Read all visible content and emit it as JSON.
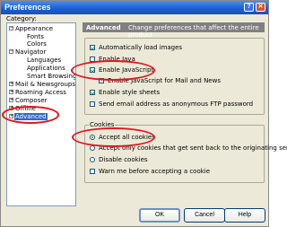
{
  "window": {
    "title": "Preferences",
    "help_glyph": "?",
    "close_glyph": "✕",
    "icons": [
      "help-icon",
      "close-icon"
    ]
  },
  "sidebar": {
    "label": "Category:",
    "items": [
      {
        "label": "Appearance",
        "toggle": "−"
      },
      {
        "label": "Fonts"
      },
      {
        "label": "Colors"
      },
      {
        "label": "Navigator",
        "toggle": "−"
      },
      {
        "label": "Languages"
      },
      {
        "label": "Applications"
      },
      {
        "label": "Smart Browsing"
      },
      {
        "label": "Mail & Newsgroups",
        "toggle": "+"
      },
      {
        "label": "Roaming Access",
        "toggle": "+"
      },
      {
        "label": "Composer",
        "toggle": "+"
      },
      {
        "label": "Offline",
        "toggle": "+"
      },
      {
        "label": "Advanced",
        "toggle": "+",
        "selected": true
      }
    ]
  },
  "panel": {
    "title": "Advanced",
    "description": "Change preferences that affect the entire product"
  },
  "options": [
    {
      "label": "Automatically load images",
      "checked": true
    },
    {
      "label": "Enable Java",
      "checked": false
    },
    {
      "label": "Enable JavaScript",
      "checked": true
    },
    {
      "label": "Enable JavaScript for Mail and News",
      "checked": false
    },
    {
      "label": "Enable style sheets",
      "checked": true
    },
    {
      "label": "Send email address as anonymous FTP password",
      "checked": false
    }
  ],
  "cookies": {
    "title": "Cookies",
    "radios": [
      {
        "label": "Accept all cookies",
        "checked": true
      },
      {
        "label": "Accept only cookies that get sent back to the originating server",
        "checked": false
      },
      {
        "label": "Disable cookies",
        "checked": false
      }
    ],
    "warn": {
      "label": "Warn me before accepting a cookie",
      "checked": false
    }
  },
  "buttons": {
    "ok": "OK",
    "cancel": "Cancel",
    "help": "Help"
  },
  "annotation_color": "#e0161e"
}
